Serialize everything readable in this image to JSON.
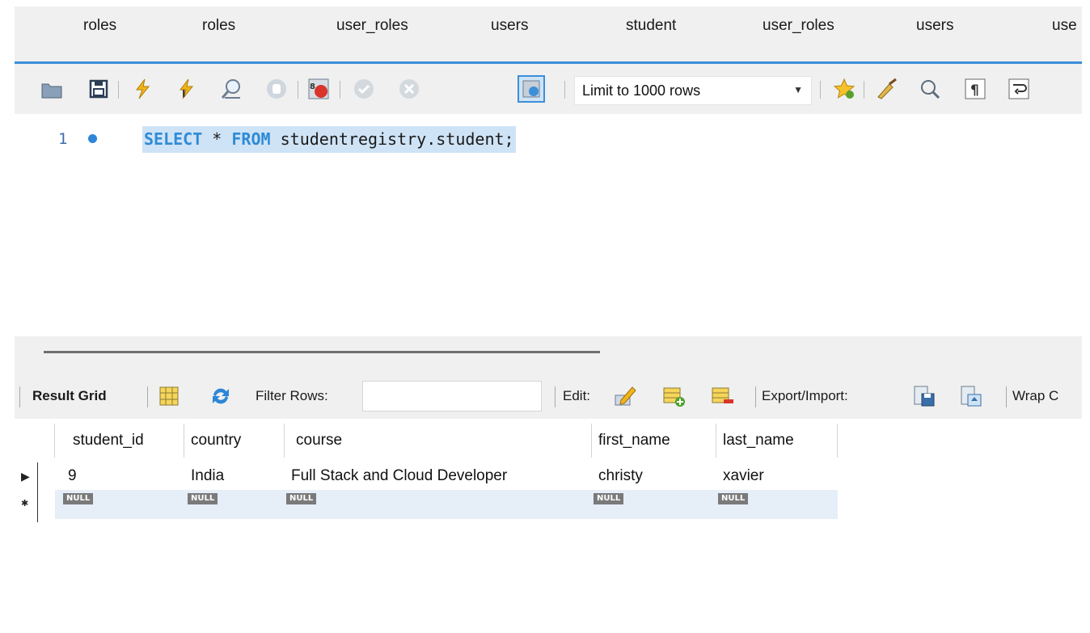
{
  "tabs": [
    "roles",
    "roles",
    "user_roles",
    "users",
    "student",
    "user_roles",
    "users",
    "use"
  ],
  "toolbar": {
    "limit_select": "Limit to 1000 rows"
  },
  "editor": {
    "line_number": "1",
    "sql_keyword_select": "SELECT",
    "sql_star": "*",
    "sql_keyword_from": "FROM",
    "sql_table": "studentregistry.student;"
  },
  "result_toolbar": {
    "result_grid_label": "Result Grid",
    "filter_rows_label": "Filter Rows:",
    "filter_value": "",
    "edit_label": "Edit:",
    "export_import_label": "Export/Import:",
    "wrap_label": "Wrap C"
  },
  "grid": {
    "columns": [
      "student_id",
      "country",
      "course",
      "first_name",
      "last_name"
    ],
    "rows": [
      [
        "9",
        "India",
        "Full Stack and Cloud Developer",
        "christy",
        "xavier"
      ]
    ],
    "null_label": "NULL",
    "current_row_marker": "▶",
    "new_row_marker": "✱"
  },
  "colors": {
    "accent": "#3b8fd9",
    "sql_keyword": "#2e8bd6",
    "selection": "#cfe3f6"
  }
}
